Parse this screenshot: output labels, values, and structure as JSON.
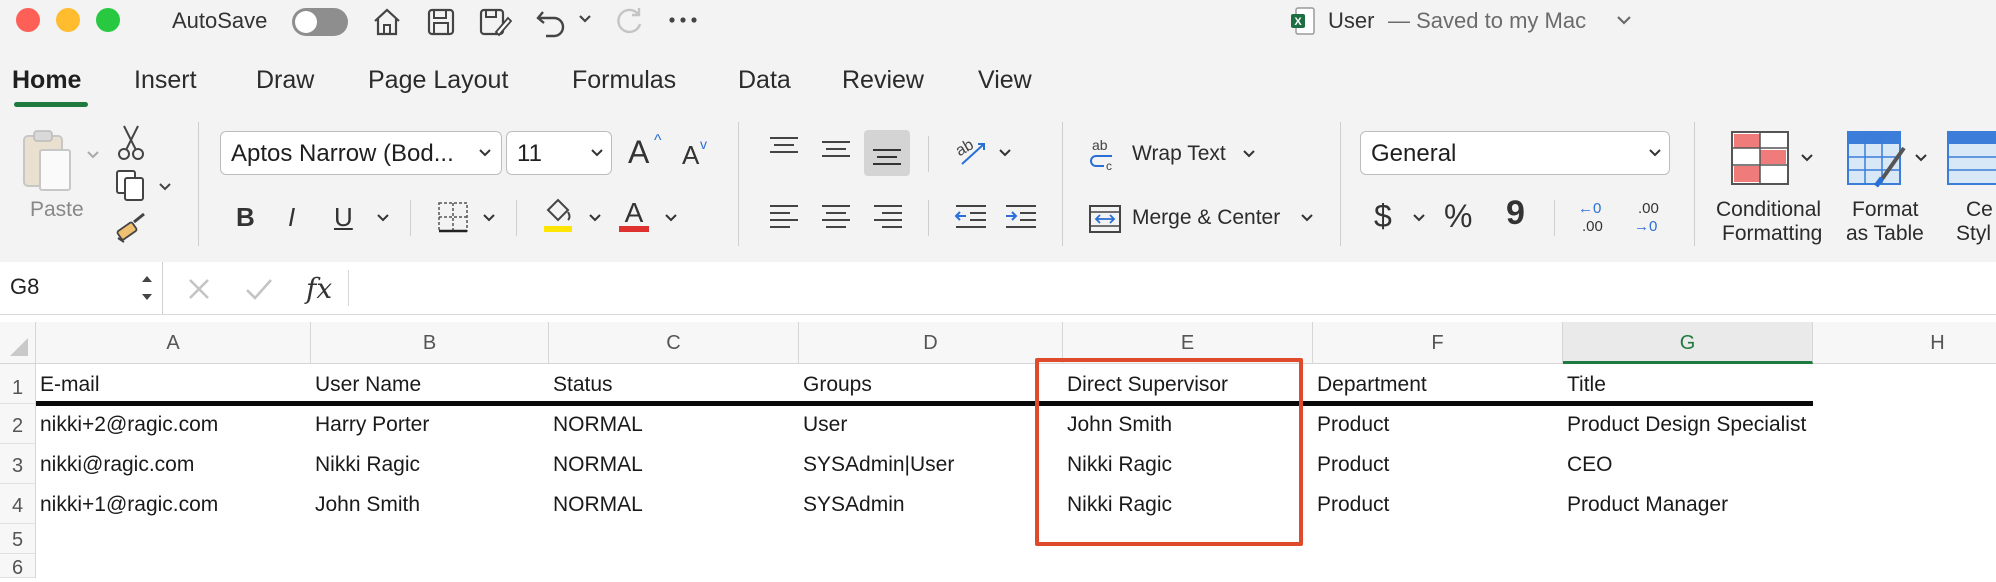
{
  "titlebar": {
    "autosave_label": "AutoSave",
    "doc_title": "User",
    "doc_status": "— Saved to my Mac"
  },
  "tabs": [
    "Home",
    "Insert",
    "Draw",
    "Page Layout",
    "Formulas",
    "Data",
    "Review",
    "View"
  ],
  "ribbon": {
    "paste_label": "Paste",
    "font_name": "Aptos Narrow (Bod...",
    "font_size": "11",
    "grow_font": "A",
    "shrink_font": "A",
    "bold": "B",
    "italic": "I",
    "underline": "U",
    "wrap_text": "Wrap Text",
    "merge_center": "Merge & Center",
    "number_format": "General",
    "currency": "$",
    "percent": "%",
    "comma": "9",
    "dec_inc_top": "←0",
    "dec_inc_bot": ".00",
    "dec_dec_top": ".00",
    "dec_dec_bot": "→0",
    "cond_format_1": "Conditional",
    "cond_format_2": "Formatting",
    "format_table_1": "Format",
    "format_table_2": "as Table",
    "cell_styles_1": "Ce",
    "cell_styles_2": "Styl"
  },
  "formula": {
    "name_box": "G8",
    "fx": "fx",
    "content": ""
  },
  "sheet": {
    "columns": [
      "A",
      "B",
      "C",
      "D",
      "E",
      "F",
      "G",
      "H"
    ],
    "selected_column": "G",
    "rows": [
      "1",
      "2",
      "3",
      "4",
      "5",
      "6"
    ],
    "cells": [
      [
        "E-mail",
        "User Name",
        "Status",
        "Groups",
        "Direct Supervisor",
        "Department",
        "Title"
      ],
      [
        "nikki+2@ragic.com",
        "Harry Porter",
        "NORMAL",
        "User",
        "John Smith",
        "Product",
        "Product Design Specialist"
      ],
      [
        "nikki@ragic.com",
        "Nikki Ragic",
        "NORMAL",
        "SYSAdmin|User",
        "Nikki Ragic",
        "Product",
        "CEO"
      ],
      [
        "nikki+1@ragic.com",
        "John Smith",
        "NORMAL",
        "SYSAdmin",
        "Nikki Ragic",
        "Product",
        "Product Manager"
      ]
    ]
  },
  "colors": {
    "accent_green": "#1f7a3f",
    "highlight_red": "#e04a2c",
    "font_color_red": "#e03131",
    "highlight_yellow": "#ffe500"
  }
}
